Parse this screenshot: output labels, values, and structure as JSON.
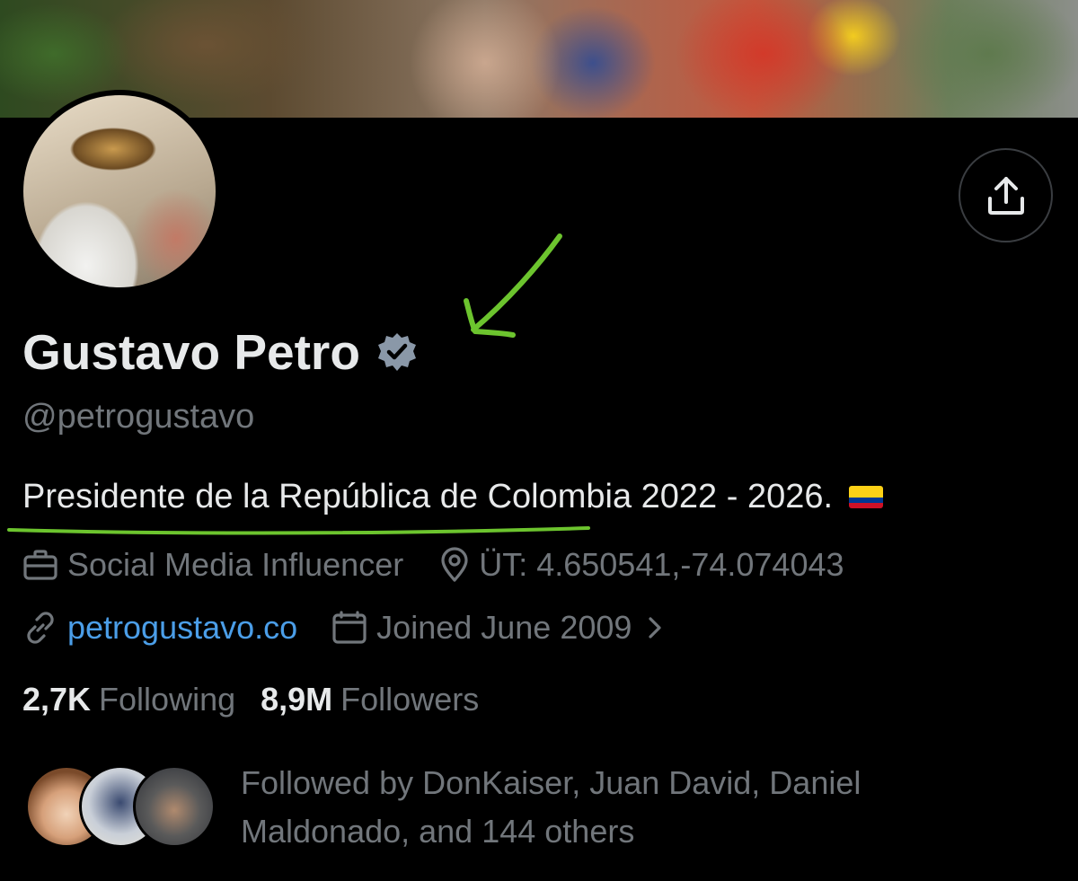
{
  "profile": {
    "name": "Gustavo Petro",
    "handle": "@petrogustavo",
    "bio": "Presidente de la República de Colombia 2022 - 2026.",
    "category": "Social Media Influencer",
    "location": "ÜT: 4.650541,-74.074043",
    "website": "petrogustavo.co",
    "joined": "Joined June 2009"
  },
  "stats": {
    "following_count": "2,7K",
    "following_label": "Following",
    "followers_count": "8,9M",
    "followers_label": "Followers"
  },
  "followed_by": {
    "text": "Followed by DonKaiser, Juan David, Daniel Maldonado, and 144 others"
  },
  "icons": {
    "share": "share-icon",
    "verified": "verified-badge-icon",
    "category": "briefcase-icon",
    "location": "location-pin-icon",
    "website": "link-icon",
    "joined": "calendar-icon",
    "flag": "colombia-flag-icon",
    "chevron": "chevron-right-icon"
  },
  "colors": {
    "background": "#000000",
    "text_primary": "#e7e9ea",
    "text_secondary": "#71767b",
    "link": "#4b9ee8",
    "annotation_green": "#6cc42e"
  }
}
